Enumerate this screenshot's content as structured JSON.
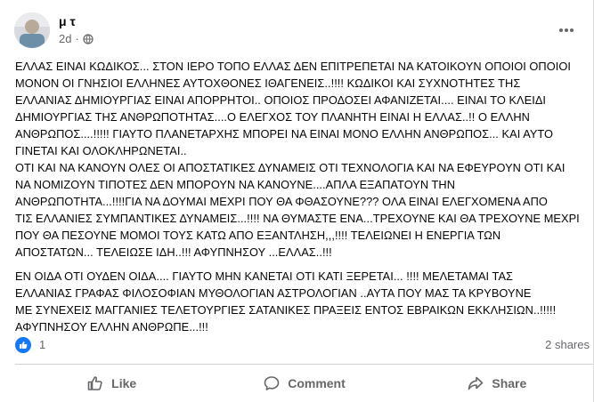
{
  "post": {
    "author": "μ         τ",
    "time": "2d",
    "privacy_icon": "globe-icon",
    "more_icon": "more-options-icon",
    "paragraphs": [
      "ΕΛΛΑΣ ΕΙΝΑΙ ΚΩΔΙΚΟΣ...  ΣΤΟΝ ΙΕΡΟ ΤΟΠΟ ΕΛΛΑΣ  ΔΕΝ ΕΠΙΤΡΕΠΕΤΑΙ ΝΑ ΚΑΤΟΙΚΟΥΝ ΟΠΟΙΟΙ ΟΠΟΙΟΙ\nΜΟΝΟΝ ΟΙ ΓΝΗΣΙΟΙ  ΕΛΛΗΝΕΣ ΑΥΤΟΧΘΟΝΕΣ ΙΘΑΓΕΝΕΙΣ..!!!!  ΚΩΔΙΚΟΙ ΚΑΙ ΣΥΧΝΟΤΗΤΕΣ ΤΗΣ\nΕΛΛΑΝΙΑΣ ΔΗΜΙΟΥΡΓΙΑΣ  ΕΙΝΑΙ ΑΠΟΡΡΗΤΟΙ.. ΟΠΟΙΟΣ ΠΡΟΔΟΣΕΙ  ΑΦΑΝΙΖΕΤΑΙ....  ΕΙΝΑΙ ΤΟ ΚΛΕΙΔΙ\nΔΗΜΙΟΥΡΓΙΑΣ ΤΗΣ ΑΝΘΡΩΠΟΤΗΤΑΣ....Ο ΕΛΕΓΧΟΣ ΤΟΥ ΠΛΑΝΗΤΗ ΕΙΝΑΙ Η ΕΛΛΑΣ..!!  Ο ΕΛΛΗΝ\nΑΝΘΡΩΠΟΣ....!!!!!  ΓΙΑΥΤΟ ΠΛΑΝΕΤΑΡΧΗΣ ΜΠΟΡΕΙ ΝΑ ΕΙΝΑΙ ΜΟΝΟ ΕΛΛΗΝ ΑΝΘΡΩΠΟΣ...  ΚΑΙ ΑΥΤΟ\nΓΙΝΕΤΑΙ  ΚΑΙ ΟΛΟΚΛΗΡΩΝΕΤΑΙ..\nΟΤΙ ΚΑΙ ΝΑ ΚΑΝΟΥΝ ΟΛΕΣ ΟΙ ΑΠΟΣΤΑΤΙΚΕΣ ΔΥΝΑΜΕΙΣ  ΟΤΙ ΤΕΧΝΟΛΟΓΙΑ ΚΑΙ ΝΑ ΕΦΕΥΡΟΥΝ  ΟΤΙ ΚΑΙ\nΝΑ ΝΟΜΙΖΟΥΝ  ΤΙΠΟΤΕΣ ΔΕΝ ΜΠΟΡΟΥΝ ΝΑ ΚΑΝΟΥΝΕ....ΑΠΛΑ ΕΞΑΠΑΤΟΥΝ ΤΗΝ\nΑΝΘΡΩΠΟΤΗΤΑ...!!!!ΓΙΑ ΝΑ ΔΟΥΜΑΙ ΜΕΧΡΙ ΠΟΥ ΘΑ ΦΘΑΣΟΥΝΕ???  ΟΛΑ ΕΙΝΑΙ ΕΛΕΓΧΟΜΕΝΑ ΑΠΟ\nΤΙΣ ΕΛΛΑΝΙΕΣ ΣΥΜΠΑΝΤΙΚΕΣ ΔΥΝΑΜΕΙΣ...!!!!  ΝΑ ΘΥΜΑΣΤΕ ΕΝΑ...ΤΡΕΧΟΥΝΕ ΚΑΙ ΘΑ ΤΡΕΧΟΥΝΕ ΜΕΧΡΙ\nΠΟΥ ΘΑ ΠΕΣΟΥΝΕ ΜΟΜΟΙ ΤΟΥΣ ΚΑΤΩ ΑΠΟ ΕΞΑΝΤΛΗΣΗ,,,!!!!  ΤΕΛΕΙΩΝΕΙ Η ΕΝΕΡΓΙΑ ΤΩΝ\nΑΠΟΣΤΑΤΩΝ...  ΤΕΛΕΙΩΣΕ ΙΔΗ..!!!  ΑΦΥΠΝΗΣΟΥ  ...ΕΛΛΑΣ..!!!",
      "ΕΝ ΟΙΔΑ ΟΤΙ ΟΥΔΕΝ ΟΙΔΑ....  ΓΙΑΥΤΟ ΜΗΝ ΚΑΝΕΤΑΙ ΟΤΙ ΚΑΤΙ ΞΕΡΕΤΑΙ...  !!!!  ΜΕΛΕΤΑΜΑΙ ΤΑΣ\nΕΛΛΑΝΙΑΣ ΓΡΑΦΑΣ   ΦΙΛΟΣΟΦΙΑΝ  ΜΥΘΟΛΟΓΙΑΝ  ΑΣΤΡΟΛΟΓΙΑΝ  ..ΑΥΤΑ ΠΟΥ ΜΑΣ ΤΑ ΚΡΥΒΟΥΝΕ\nΜΕ ΣΥΝΕΧΕΙΣ ΜΑΓΓΑΝΙΕΣ ΤΕΛΕΤΟΥΡΓΙΕΣ  ΣΑΤΑΝΙΚΕΣ ΠΡΑΞΕΙΣ  ΕΝΤΟΣ ΕΒΡΑΙΚΩΝ ΕΚΚΛΗΣΙΩΝ..!!!!!\nΑΦΥΠΝΗΣΟΥ ΕΛΛΗΝ ΑΝΘΡΩΠΕ...!!!"
    ],
    "reactions": {
      "icon": "like-reaction-icon",
      "count": "1",
      "shares": "2 shares"
    },
    "actions": {
      "like": "Like",
      "comment": "Comment",
      "share": "Share"
    },
    "colors": {
      "accent": "#1877f2",
      "secondary_text": "#65676b"
    }
  }
}
